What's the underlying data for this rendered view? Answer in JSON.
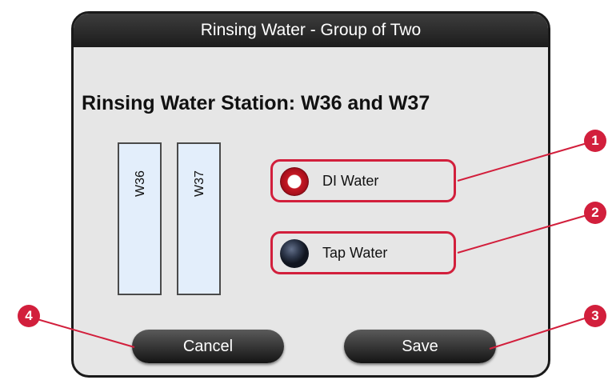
{
  "dialog": {
    "title": "Rinsing Water - Group of Two",
    "station_title": "Rinsing Water Station: W36 and W37"
  },
  "vessels": [
    {
      "label": "W36"
    },
    {
      "label": "W37"
    }
  ],
  "options": [
    {
      "label": "DI Water",
      "selected": true
    },
    {
      "label": "Tap Water",
      "selected": false
    }
  ],
  "buttons": {
    "cancel_label": "Cancel",
    "save_label": "Save"
  },
  "callouts": [
    "1",
    "2",
    "3",
    "4"
  ],
  "colors": {
    "accent": "#d21f3c",
    "titlebar": "#2a2a2a",
    "dialog_bg": "#e6e6e6"
  }
}
